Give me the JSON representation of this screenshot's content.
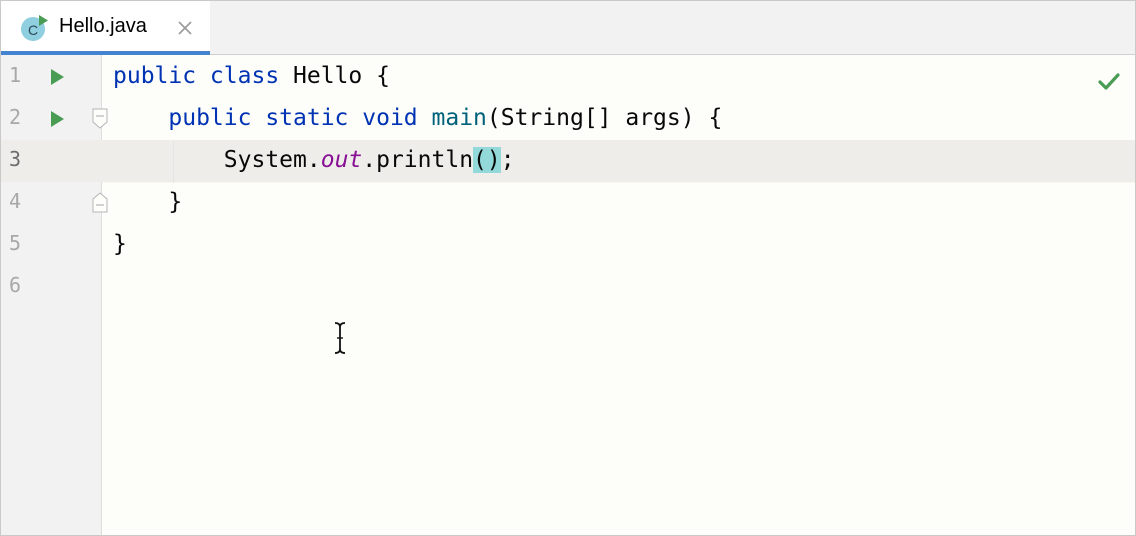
{
  "tab": {
    "icon_letter": "C",
    "label": "Hello.java"
  },
  "gutter": {
    "line_numbers": [
      "1",
      "2",
      "3",
      "4",
      "5",
      "6"
    ],
    "current_line": "3"
  },
  "code": {
    "lines": [
      {
        "parts": [
          {
            "t": "public class ",
            "c": "kw"
          },
          {
            "t": "Hello {",
            "c": ""
          }
        ]
      },
      {
        "parts": [
          {
            "t": "    ",
            "c": ""
          },
          {
            "t": "public static void ",
            "c": "kw"
          },
          {
            "t": "main",
            "c": "fn"
          },
          {
            "t": "(String[] args) {",
            "c": ""
          }
        ]
      },
      {
        "parts": [
          {
            "t": "        System.",
            "c": ""
          },
          {
            "t": "out",
            "c": "field"
          },
          {
            "t": ".println",
            "c": ""
          },
          {
            "t": "()",
            "c": "paren-hl"
          },
          {
            "t": ";",
            "c": ""
          }
        ]
      },
      {
        "parts": [
          {
            "t": "    }",
            "c": ""
          }
        ]
      },
      {
        "parts": [
          {
            "t": "}",
            "c": ""
          }
        ]
      },
      {
        "parts": [
          {
            "t": "",
            "c": ""
          }
        ]
      }
    ]
  },
  "status": {
    "inspection_icon": "check-icon",
    "inspection_color": "#499c54"
  },
  "colors": {
    "keyword": "#0033b3",
    "function": "#00627a",
    "field": "#871094",
    "run_icon": "#499c54",
    "tab_accent": "#4383cf",
    "class_icon_bg": "#8fcfe0"
  }
}
